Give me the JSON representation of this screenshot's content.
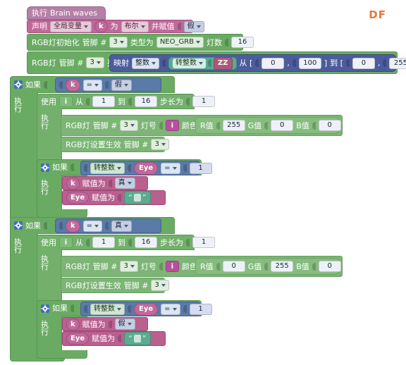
{
  "app": {
    "logo": "DF",
    "logo_color": "#e8763a",
    "background": "#ffffff"
  },
  "program": {
    "hat": {
      "run_label": "执行",
      "name": "Brain waves"
    },
    "declare": {
      "label": "声明",
      "scope": "全局变量",
      "var_name": "k",
      "as_label": "为",
      "type": "布尔",
      "assign_label": "并赋值",
      "value": "假"
    },
    "rgb_init": {
      "label": "RGB灯初始化",
      "pin_label": "管脚 #",
      "pin": "3",
      "type_label": "类型为",
      "type": "NEO_GRB",
      "count_label": "灯数",
      "count": "16"
    },
    "rgb_brightness": {
      "label": "RGB灯",
      "pin_label": "管脚 #",
      "pin": "3",
      "brightness_label": "亮度",
      "map_label": "映射",
      "map_type": "整数",
      "to_int_label": "转整数",
      "source": "ZZ",
      "from_label": "从 [",
      "from_min": "0",
      "comma": ",",
      "from_max": "100",
      "close_from": "]",
      "to_label": "到 [",
      "to_min": "0",
      "to_max": "255",
      "close_to": "]"
    },
    "if_blocks": [
      {
        "if_label": "如果",
        "cond_var": "k",
        "cond_op": "=",
        "cond_value": "假",
        "do_label": "执行",
        "loop": {
          "use_label": "使用",
          "counter": "i",
          "from_label": "从",
          "from": "1",
          "to_label": "到",
          "to": "16",
          "step_label": "步长为",
          "step": "1",
          "do_label": "执行",
          "set_pixel": {
            "label": "RGB灯",
            "pin_label": "管脚 #",
            "pin": "3",
            "index_label": "灯号",
            "index": "i",
            "color_label": "颜色",
            "r_label": "R值",
            "r": "255",
            "g_label": "G值",
            "g": "0",
            "b_label": "B值",
            "b": "0"
          },
          "show": {
            "label": "RGB灯设置生效",
            "pin_label": "管脚 #",
            "pin": "3"
          }
        },
        "inner_if": {
          "if_label": "如果",
          "to_int_label": "转整数",
          "cond_var": "Eye",
          "cond_op": "=",
          "cond_value": "1",
          "do_label": "执行",
          "set_k": {
            "var": "k",
            "label": "赋值为",
            "value": "真"
          },
          "set_eye": {
            "var": "Eye",
            "label": "赋值为",
            "value": ""
          }
        }
      },
      {
        "if_label": "如果",
        "cond_var": "k",
        "cond_op": "=",
        "cond_value": "真",
        "do_label": "执行",
        "loop": {
          "use_label": "使用",
          "counter": "i",
          "from_label": "从",
          "from": "1",
          "to_label": "到",
          "to": "16",
          "step_label": "步长为",
          "step": "1",
          "do_label": "执行",
          "set_pixel": {
            "label": "RGB灯",
            "pin_label": "管脚 #",
            "pin": "3",
            "index_label": "灯号",
            "index": "i",
            "color_label": "颜色",
            "r_label": "R值",
            "r": "0",
            "g_label": "G值",
            "g": "255",
            "b_label": "B值",
            "b": "0"
          },
          "show": {
            "label": "RGB灯设置生效",
            "pin_label": "管脚 #",
            "pin": "3"
          }
        },
        "inner_if": {
          "if_label": "如果",
          "to_int_label": "转整数",
          "cond_var": "Eye",
          "cond_op": "=",
          "cond_value": "1",
          "do_label": "执行",
          "set_k": {
            "var": "k",
            "label": "赋值为",
            "value": "假"
          },
          "set_eye": {
            "var": "Eye",
            "label": "赋值为",
            "value": ""
          }
        }
      }
    ]
  }
}
